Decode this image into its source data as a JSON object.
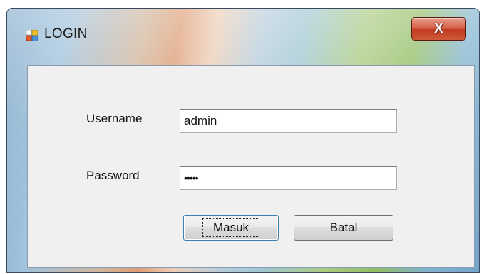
{
  "window": {
    "title": "LOGIN",
    "close_glyph": "X"
  },
  "form": {
    "username_label": "Username",
    "username_value": "admin",
    "password_label": "Password",
    "password_value": "•••••"
  },
  "buttons": {
    "submit_label": "Masuk",
    "cancel_label": "Batal"
  },
  "colors": {
    "client_bg": "#f0f0f0",
    "close_red": "#c23a20",
    "focus_border": "#3c7fb1"
  },
  "icons": {
    "app": "window-app-icon"
  }
}
